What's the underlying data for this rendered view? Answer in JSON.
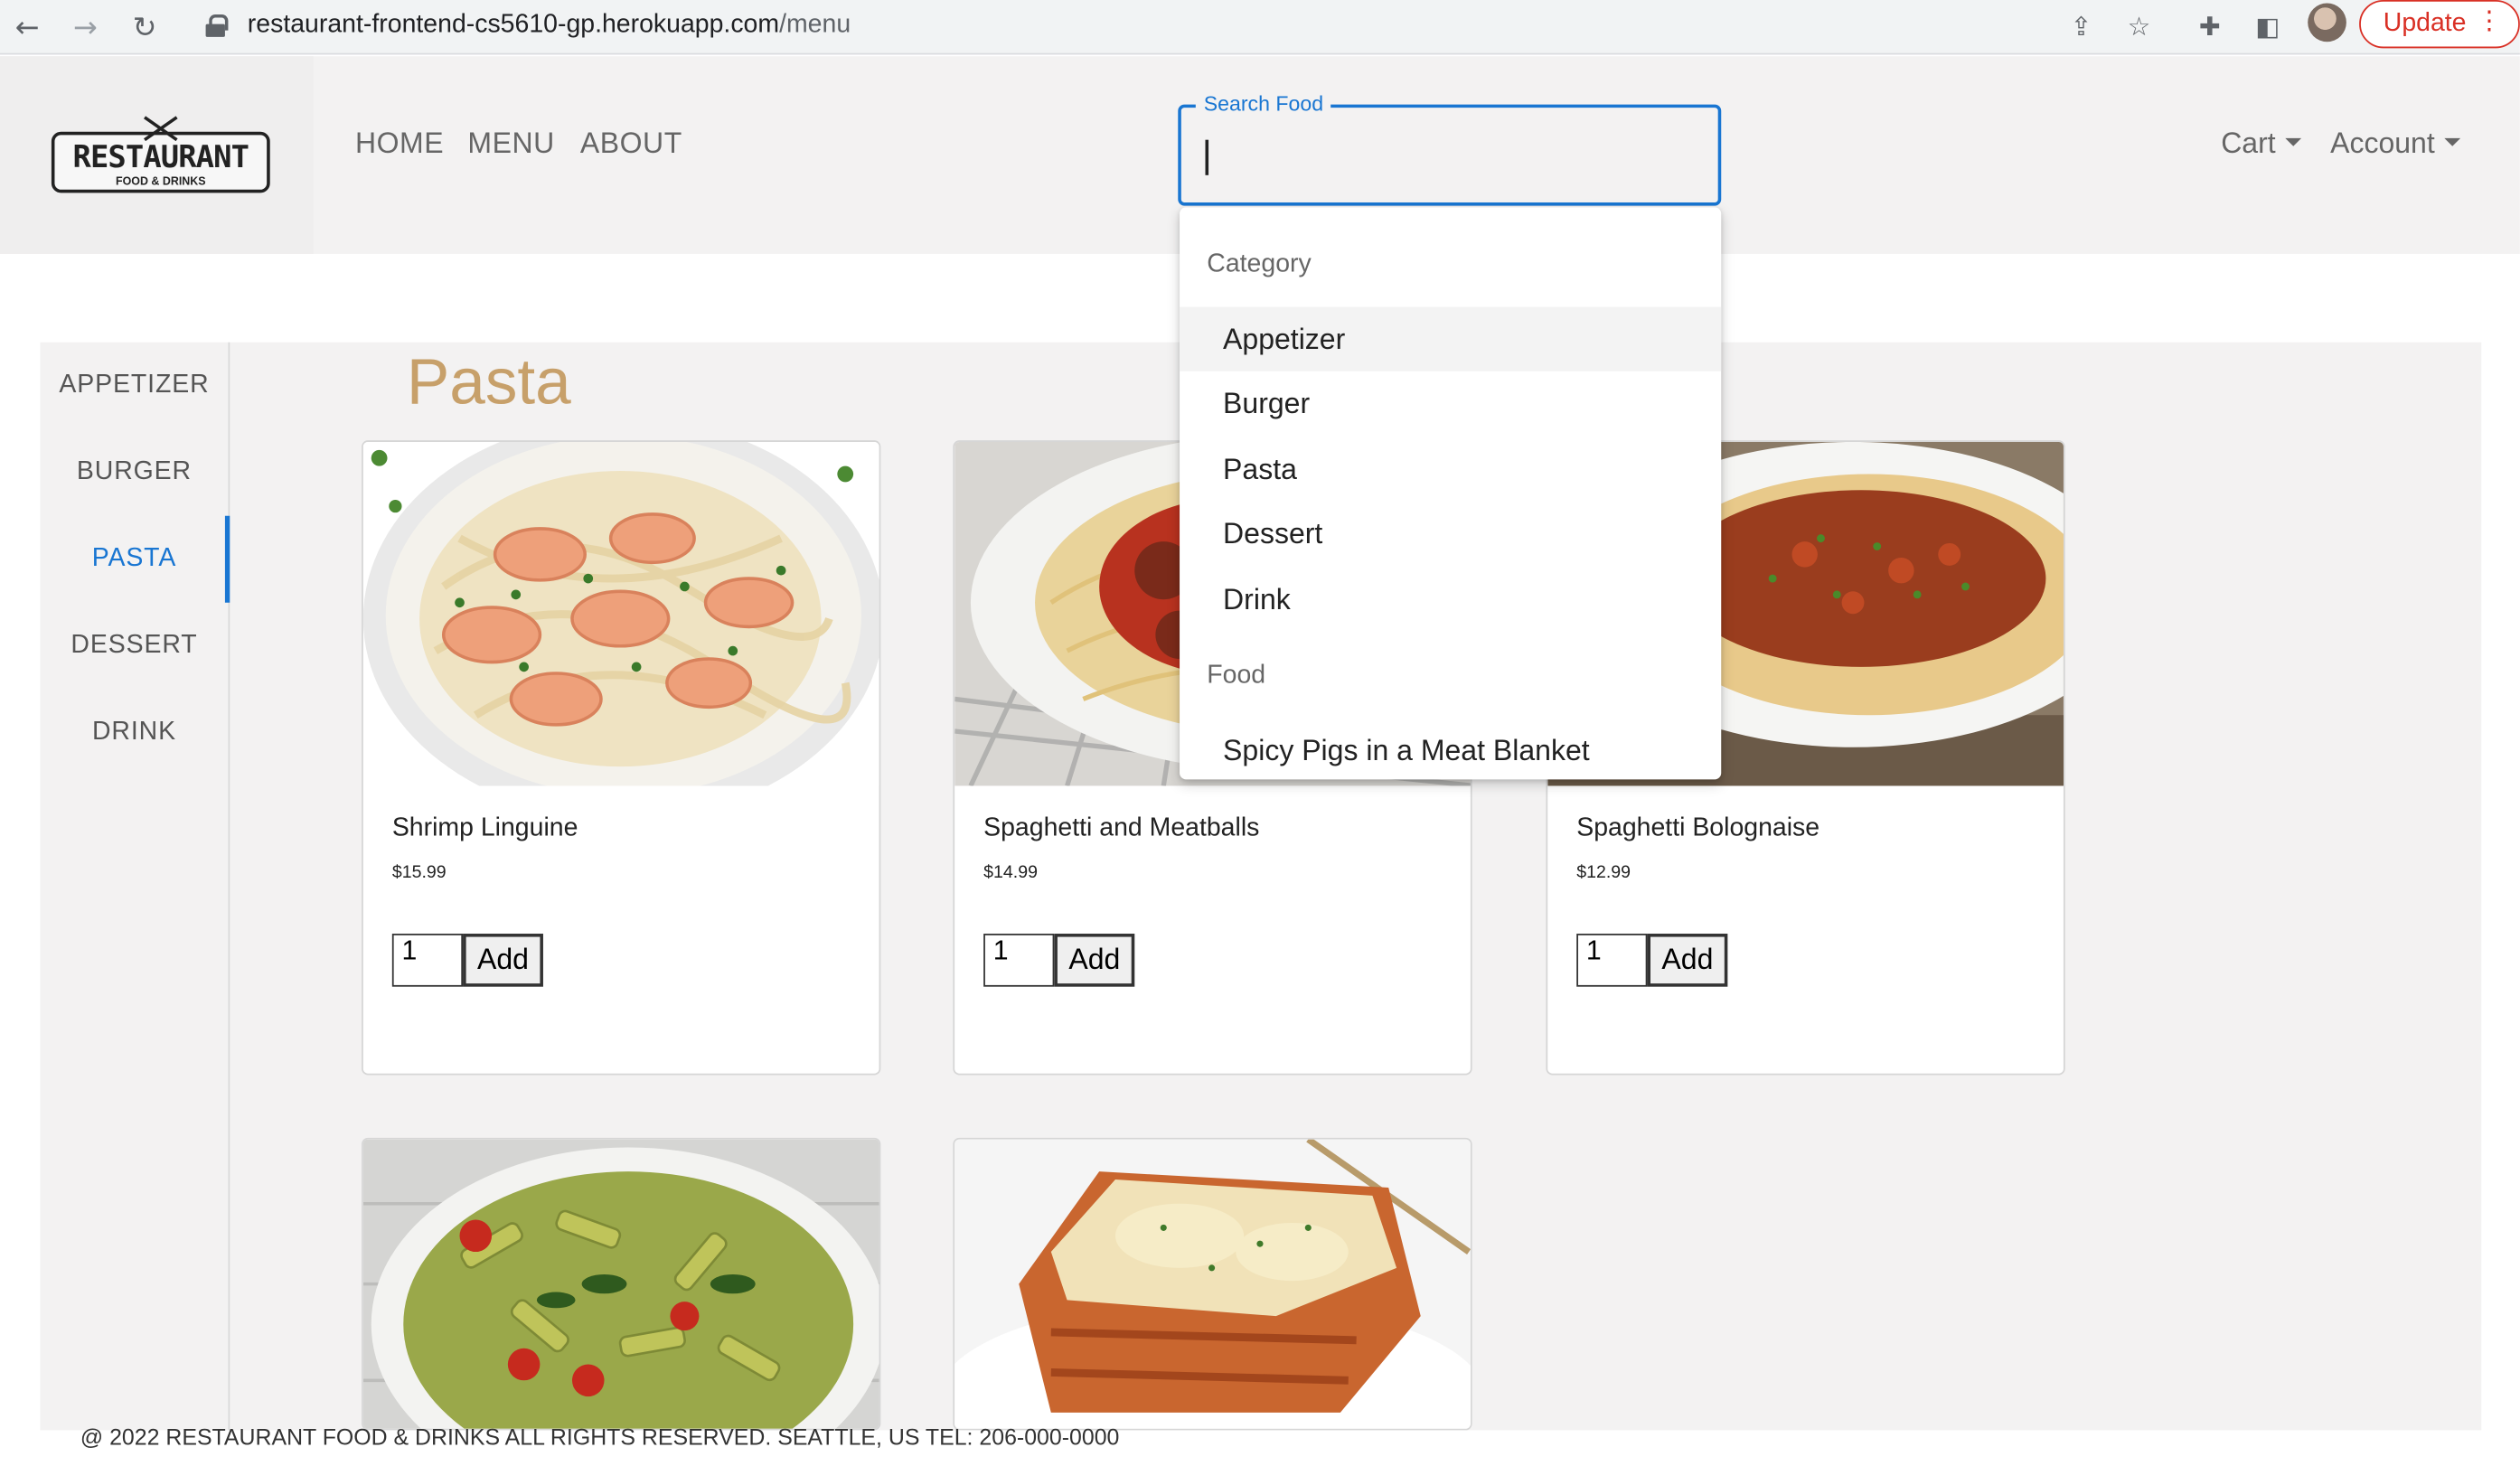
{
  "browser": {
    "url_host": "restaurant-frontend-cs5610-gp.herokuapp.com",
    "url_path": "/menu",
    "update_label": "Update"
  },
  "navbar": {
    "logo_text": "RESTAURANT",
    "logo_sub": "FOOD & DRINKS",
    "links": [
      "HOME",
      "MENU",
      "ABOUT"
    ],
    "cart_label": "Cart",
    "account_label": "Account"
  },
  "search": {
    "label": "Search Food",
    "value": ""
  },
  "listbox": {
    "category_header": "Category",
    "categories": [
      "Appetizer",
      "Burger",
      "Pasta",
      "Dessert",
      "Drink"
    ],
    "food_header": "Food",
    "foods": [
      "Spicy Pigs in a Meat Blanket"
    ]
  },
  "sidebar": {
    "items": [
      "APPETIZER",
      "BURGER",
      "PASTA",
      "DESSERT",
      "DRINK"
    ],
    "active": "PASTA"
  },
  "section_title": "Pasta",
  "cards": [
    {
      "name": "Shrimp Linguine",
      "price": "$15.99",
      "qty": "1",
      "add_label": "Add"
    },
    {
      "name": "Spaghetti and Meatballs",
      "price": "$14.99",
      "qty": "1",
      "add_label": "Add"
    },
    {
      "name": "Spaghetti Bolognaise",
      "price": "$12.99",
      "qty": "1",
      "add_label": "Add"
    },
    {
      "name": "",
      "price": "",
      "qty": "",
      "add_label": ""
    },
    {
      "name": "",
      "price": "",
      "qty": "",
      "add_label": ""
    }
  ],
  "footer": "@ 2022 RESTAURANT FOOD & DRINKS ALL RIGHTS RESERVED. SEATTLE, US TEL: 206-000-0000",
  "colors": {
    "accent": "#1976d2",
    "title": "#c7a06a",
    "update": "#d93025"
  }
}
